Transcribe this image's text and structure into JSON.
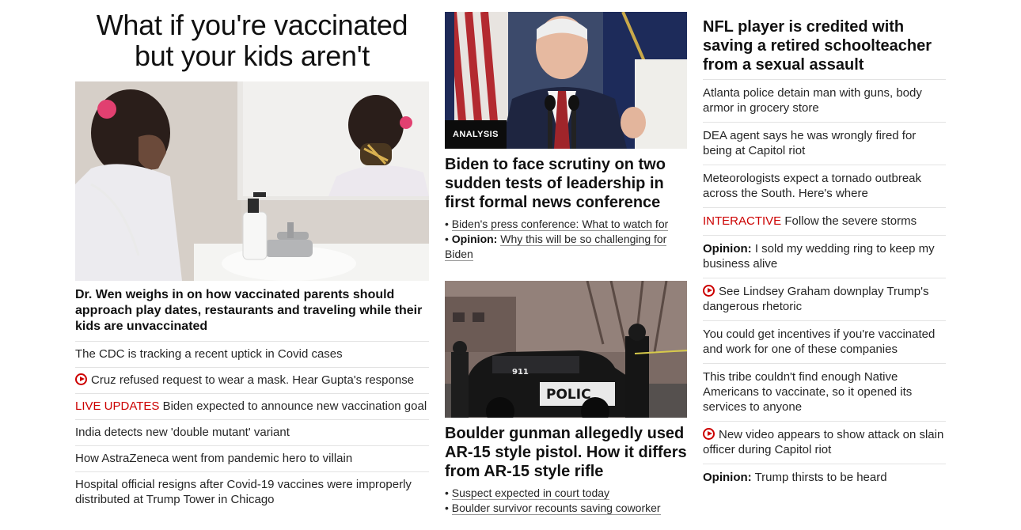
{
  "col1": {
    "headline": "What if you're vaccinated but your kids aren't",
    "hero_title": "Dr. Wen weighs in on how vaccinated parents should approach play dates, restaurants and traveling while their kids are unvaccinated",
    "items": [
      {
        "prefix": "",
        "text": "The CDC is tracking a recent uptick in Covid cases",
        "video": false
      },
      {
        "prefix": "",
        "text": "Cruz refused request to wear a mask. Hear Gupta's response",
        "video": true
      },
      {
        "prefix": "LIVE UPDATES",
        "text": "Biden expected to announce new vaccination goal",
        "video": false
      },
      {
        "prefix": "",
        "text": "India detects new 'double mutant' variant",
        "video": false
      },
      {
        "prefix": "",
        "text": "How AstraZeneca went from pandemic hero to villain",
        "video": false
      },
      {
        "prefix": "",
        "text": "Hospital official resigns after Covid-19 vaccines were improperly distributed at Trump Tower in Chicago",
        "video": false
      }
    ]
  },
  "col2": {
    "story1": {
      "badge": "ANALYSIS",
      "title": "Biden to face scrutiny on two sudden tests of leadership in first formal news conference",
      "link1": "Biden's press conference: What to watch for",
      "link2_label": "Opinion:",
      "link2": "Why this will be so challenging for Biden"
    },
    "story2": {
      "police_text": "POLIC",
      "unit_number": "911",
      "title": "Boulder gunman allegedly used AR-15 style pistol. How it differs from AR-15 style rifle",
      "link1": "Suspect expected in court today",
      "link2": "Boulder survivor recounts saving coworker"
    }
  },
  "col3": {
    "lead": "NFL player is credited with saving a retired schoolteacher from a sexual assault",
    "items": [
      {
        "prefix": "",
        "label": "",
        "text": "Atlanta police detain man with guns, body armor in grocery store",
        "video": false
      },
      {
        "prefix": "",
        "label": "",
        "text": "DEA agent says he was wrongly fired for being at Capitol riot",
        "video": false
      },
      {
        "prefix": "",
        "label": "",
        "text": "Meteorologists expect a tornado outbreak across the South. Here's where",
        "video": false
      },
      {
        "prefix": "INTERACTIVE",
        "label": "",
        "text": "Follow the severe storms",
        "video": false
      },
      {
        "prefix": "",
        "label": "Opinion:",
        "text": "I sold my wedding ring to keep my business alive",
        "video": false
      },
      {
        "prefix": "",
        "label": "",
        "text": "See Lindsey Graham downplay Trump's dangerous rhetoric",
        "video": true
      },
      {
        "prefix": "",
        "label": "",
        "text": "You could get incentives if you're vaccinated and work for one of these companies",
        "video": false
      },
      {
        "prefix": "",
        "label": "",
        "text": "This tribe couldn't find enough Native Americans to vaccinate, so it opened its services to anyone",
        "video": false
      },
      {
        "prefix": "",
        "label": "",
        "text": "New video appears to show attack on slain officer during Capitol riot",
        "video": true
      },
      {
        "prefix": "",
        "label": "Opinion:",
        "text": "Trump thirsts to be heard",
        "video": false
      }
    ]
  },
  "colors": {
    "accent": "#cc0000",
    "text": "#262626",
    "divider": "#e3e3e3"
  }
}
